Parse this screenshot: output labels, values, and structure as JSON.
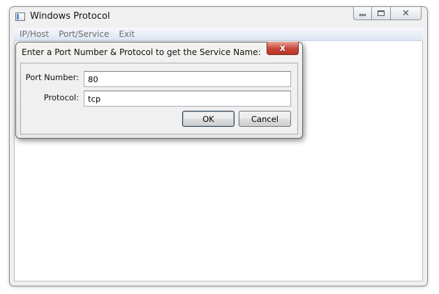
{
  "window": {
    "title": "Windows Protocol"
  },
  "caption": {
    "minimize_icon": "minimize-icon",
    "maximize_icon": "maximize-icon",
    "close_glyph": "✕"
  },
  "menu": {
    "items": [
      {
        "label": "IP/Host"
      },
      {
        "label": "Port/Service"
      },
      {
        "label": "Exit"
      }
    ]
  },
  "dialog": {
    "title": "Enter a Port Number & Protocol to get the Service Name:",
    "close_glyph": "x",
    "fields": {
      "port": {
        "label": "Port Number:",
        "value": "80"
      },
      "protocol": {
        "label": "Protocol:",
        "value": "tcp"
      }
    },
    "buttons": {
      "ok": "OK",
      "cancel": "Cancel"
    }
  },
  "colors": {
    "dialog_close_red": "#c8463a",
    "menubar_blue": "#dde6f3"
  }
}
